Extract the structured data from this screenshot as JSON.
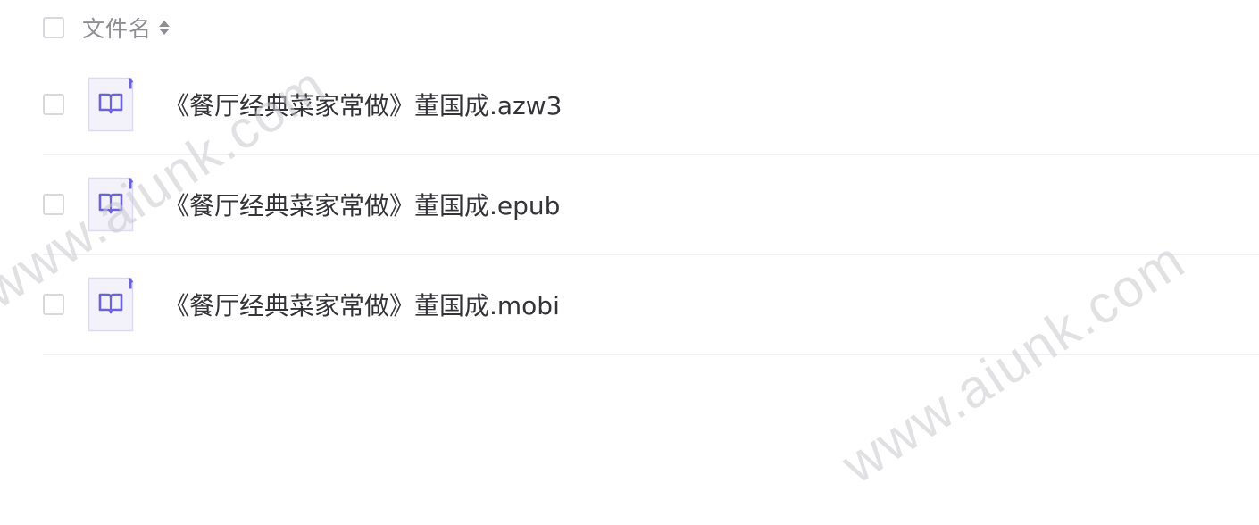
{
  "header": {
    "column_label": "文件名",
    "sort_icon": "sort-both-icon"
  },
  "files": [
    {
      "name": "《餐厅经典菜家常做》董国成.azw3",
      "icon": "ebook-icon"
    },
    {
      "name": "《餐厅经典菜家常做》董国成.epub",
      "icon": "ebook-icon"
    },
    {
      "name": "《餐厅经典菜家常做》董国成.mobi",
      "icon": "ebook-icon"
    }
  ],
  "watermarks": [
    "www.aiunk.com",
    "www.aiunk.com"
  ],
  "colors": {
    "icon_accent": "#6b63d9",
    "icon_bg": "#f3f2fb",
    "text": "#333338",
    "header_text": "#8e8e93",
    "divider": "#f1f1f3"
  }
}
